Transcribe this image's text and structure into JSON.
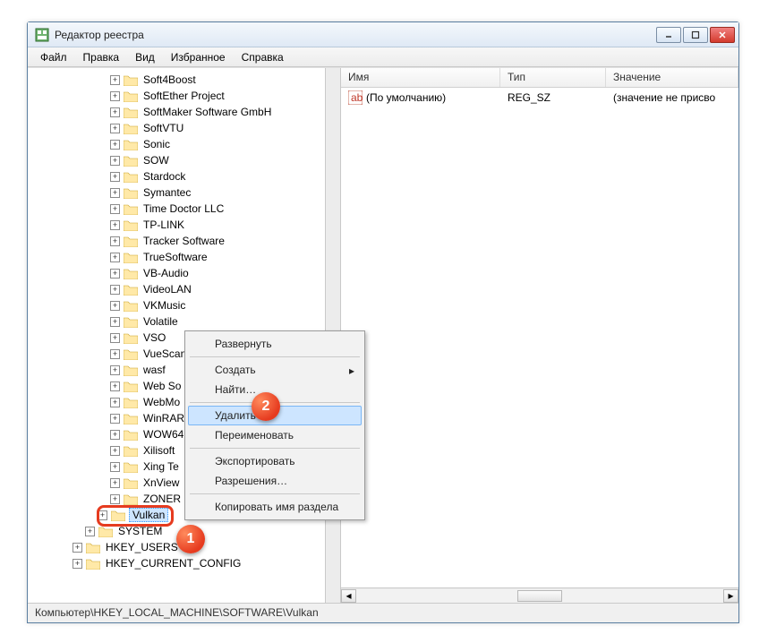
{
  "title": "Редактор реестра",
  "menu": {
    "file": "Файл",
    "edit": "Правка",
    "view": "Вид",
    "favorites": "Избранное",
    "help": "Справка"
  },
  "tree": {
    "items": [
      "Soft4Boost",
      "SoftEther Project",
      "SoftMaker Software GmbH",
      "SoftVTU",
      "Sonic",
      "SOW",
      "Stardock",
      "Symantec",
      "Time Doctor LLC",
      "TP-LINK",
      "Tracker Software",
      "TrueSoftware",
      "VB-Audio",
      "VideoLAN",
      "VKMusic",
      "Volatile",
      "VSO",
      "VueScan",
      "wasf",
      "Web So",
      "WebMo",
      "WinRAR",
      "WOW64",
      "Xilisoft",
      "Xing Te",
      "XnView",
      "ZONER"
    ],
    "selected": "Vulkan",
    "system": "SYSTEM",
    "roots": [
      "HKEY_USERS",
      "HKEY_CURRENT_CONFIG"
    ]
  },
  "list": {
    "cols": {
      "name": "Имя",
      "type": "Тип",
      "data": "Значение"
    },
    "row": {
      "name": "(По умолчанию)",
      "type": "REG_SZ",
      "data": "(значение не присво"
    }
  },
  "context": {
    "expand": "Развернуть",
    "create": "Создать",
    "find": "Найти…",
    "delete": "Удалить",
    "rename": "Переименовать",
    "export": "Экспортировать",
    "permissions": "Разрешения…",
    "copy_key": "Копировать имя раздела"
  },
  "status": "Компьютер\\HKEY_LOCAL_MACHINE\\SOFTWARE\\Vulkan",
  "badges": {
    "b1": "1",
    "b2": "2"
  }
}
